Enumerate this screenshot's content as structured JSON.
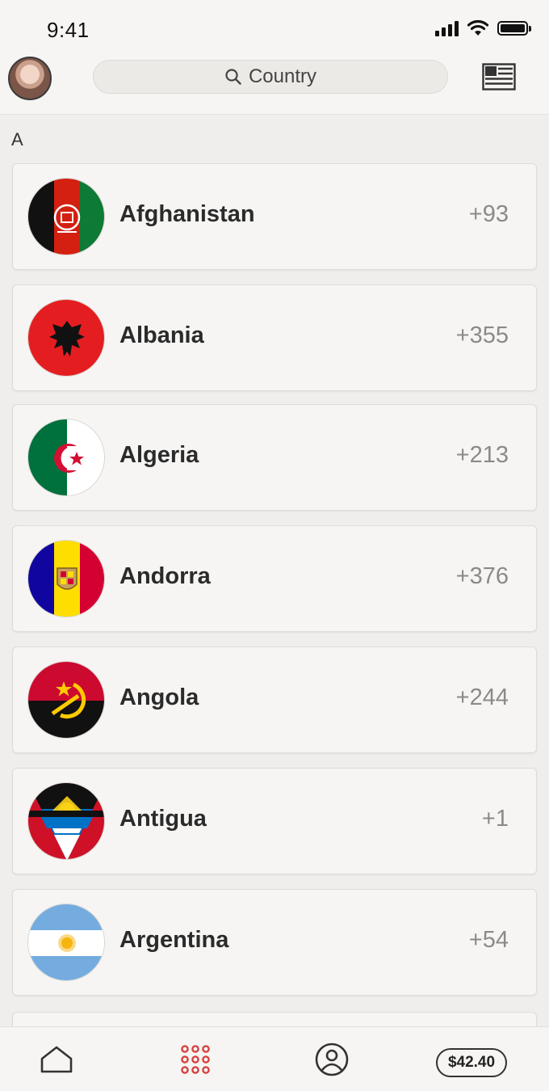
{
  "status_bar": {
    "time": "9:41"
  },
  "header": {
    "search_placeholder": "Country"
  },
  "section": {
    "letter": "A"
  },
  "countries": [
    {
      "name": "Afghanistan",
      "code": "+93",
      "flag": "afghanistan-flag-icon"
    },
    {
      "name": "Albania",
      "code": "+355",
      "flag": "albania-flag-icon"
    },
    {
      "name": "Algeria",
      "code": "+213",
      "flag": "algeria-flag-icon"
    },
    {
      "name": "Andorra",
      "code": "+376",
      "flag": "andorra-flag-icon"
    },
    {
      "name": "Angola",
      "code": "+244",
      "flag": "angola-flag-icon"
    },
    {
      "name": "Antigua",
      "code": "+1",
      "flag": "antigua-flag-icon"
    },
    {
      "name": "Argentina",
      "code": "+54",
      "flag": "argentina-flag-icon"
    }
  ],
  "bottom_nav": {
    "items": [
      {
        "icon": "home-icon"
      },
      {
        "icon": "dialpad-icon",
        "active": true
      },
      {
        "icon": "profile-icon"
      }
    ],
    "balance": "$42.40"
  },
  "colors": {
    "accent": "#d6403f",
    "card": "#f6f5f3",
    "background": "#efeeec"
  }
}
